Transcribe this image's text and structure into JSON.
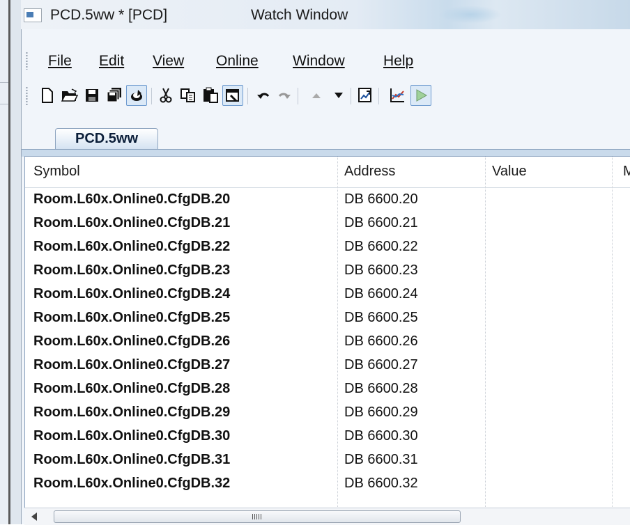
{
  "window": {
    "document_title": "PCD.5ww * [PCD]",
    "window_title": "Watch Window"
  },
  "menu": [
    {
      "label": "File"
    },
    {
      "label": "Edit"
    },
    {
      "label": "View"
    },
    {
      "label": "Online"
    },
    {
      "label": "Window"
    },
    {
      "label": "Help"
    }
  ],
  "toolbar": {
    "buttons": [
      {
        "icon": "new-file-icon"
      },
      {
        "icon": "open-folder-icon"
      },
      {
        "icon": "save-icon"
      },
      {
        "icon": "save-all-icon"
      },
      {
        "icon": "save-as-icon"
      },
      {
        "icon": "cut-icon"
      },
      {
        "icon": "copy-icon"
      },
      {
        "icon": "paste-icon"
      },
      {
        "icon": "properties-icon"
      },
      {
        "icon": "undo-icon"
      },
      {
        "icon": "redo-icon"
      },
      {
        "icon": "move-up-icon"
      },
      {
        "icon": "move-down-icon"
      },
      {
        "icon": "watch-icon"
      },
      {
        "icon": "trend-chart-icon"
      },
      {
        "icon": "go-online-icon"
      }
    ]
  },
  "tab": {
    "label": "PCD.5ww"
  },
  "grid": {
    "columns": [
      "Symbol",
      "Address",
      "Value",
      "M"
    ],
    "rows": [
      {
        "symbol": "Room.L60x.Online0.CfgDB.20",
        "address": "DB 6600.20",
        "value": ""
      },
      {
        "symbol": "Room.L60x.Online0.CfgDB.21",
        "address": "DB 6600.21",
        "value": ""
      },
      {
        "symbol": "Room.L60x.Online0.CfgDB.22",
        "address": "DB 6600.22",
        "value": ""
      },
      {
        "symbol": "Room.L60x.Online0.CfgDB.23",
        "address": "DB 6600.23",
        "value": ""
      },
      {
        "symbol": "Room.L60x.Online0.CfgDB.24",
        "address": "DB 6600.24",
        "value": ""
      },
      {
        "symbol": "Room.L60x.Online0.CfgDB.25",
        "address": "DB 6600.25",
        "value": ""
      },
      {
        "symbol": "Room.L60x.Online0.CfgDB.26",
        "address": "DB 6600.26",
        "value": ""
      },
      {
        "symbol": "Room.L60x.Online0.CfgDB.27",
        "address": "DB 6600.27",
        "value": ""
      },
      {
        "symbol": "Room.L60x.Online0.CfgDB.28",
        "address": "DB 6600.28",
        "value": ""
      },
      {
        "symbol": "Room.L60x.Online0.CfgDB.29",
        "address": "DB 6600.29",
        "value": ""
      },
      {
        "symbol": "Room.L60x.Online0.CfgDB.30",
        "address": "DB 6600.30",
        "value": ""
      },
      {
        "symbol": "Room.L60x.Online0.CfgDB.31",
        "address": "DB 6600.31",
        "value": ""
      },
      {
        "symbol": "Room.L60x.Online0.CfgDB.32",
        "address": "DB 6600.32",
        "value": ""
      }
    ]
  }
}
